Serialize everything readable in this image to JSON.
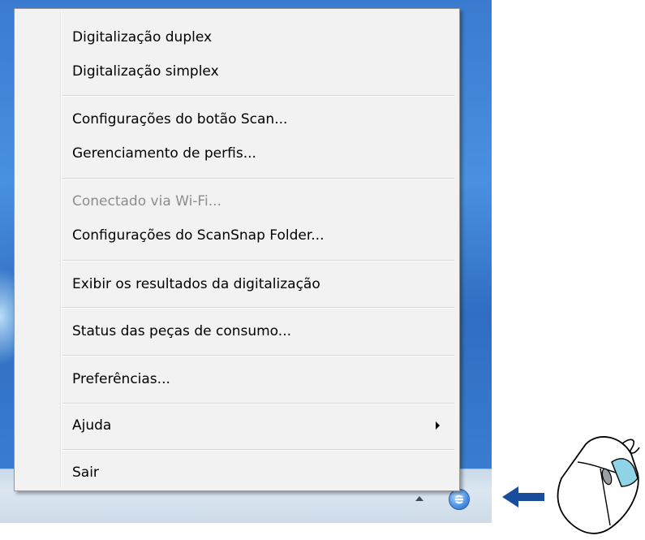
{
  "menu": {
    "items": [
      {
        "label": "Digitalização duplex",
        "enabled": true
      },
      {
        "label": "Digitalização simplex",
        "enabled": true
      },
      {
        "label": "Configurações do botão Scan...",
        "enabled": true
      },
      {
        "label": "Gerenciamento de perfis...",
        "enabled": true
      },
      {
        "label": "Conectado via Wi-Fi...",
        "enabled": false
      },
      {
        "label": "Configurações do ScanSnap Folder...",
        "enabled": true
      },
      {
        "label": "Exibir os resultados da digitalização",
        "enabled": true
      },
      {
        "label": "Status das peças de consumo...",
        "enabled": true
      },
      {
        "label": "Preferências...",
        "enabled": true
      },
      {
        "label": "Ajuda",
        "enabled": true,
        "submenu": true
      },
      {
        "label": "Sair",
        "enabled": true
      }
    ]
  },
  "taskbar": {
    "tray_icons": [
      "show-hidden-icons-arrow-icon",
      "scansnap-manager-icon"
    ]
  },
  "annotation": {
    "arrow_icon": "left-arrow-icon",
    "mouse_icon": "mouse-right-click-icon",
    "arrow_color": "#1a4c9c",
    "mouse_highlight_color": "#8fd3e6"
  }
}
